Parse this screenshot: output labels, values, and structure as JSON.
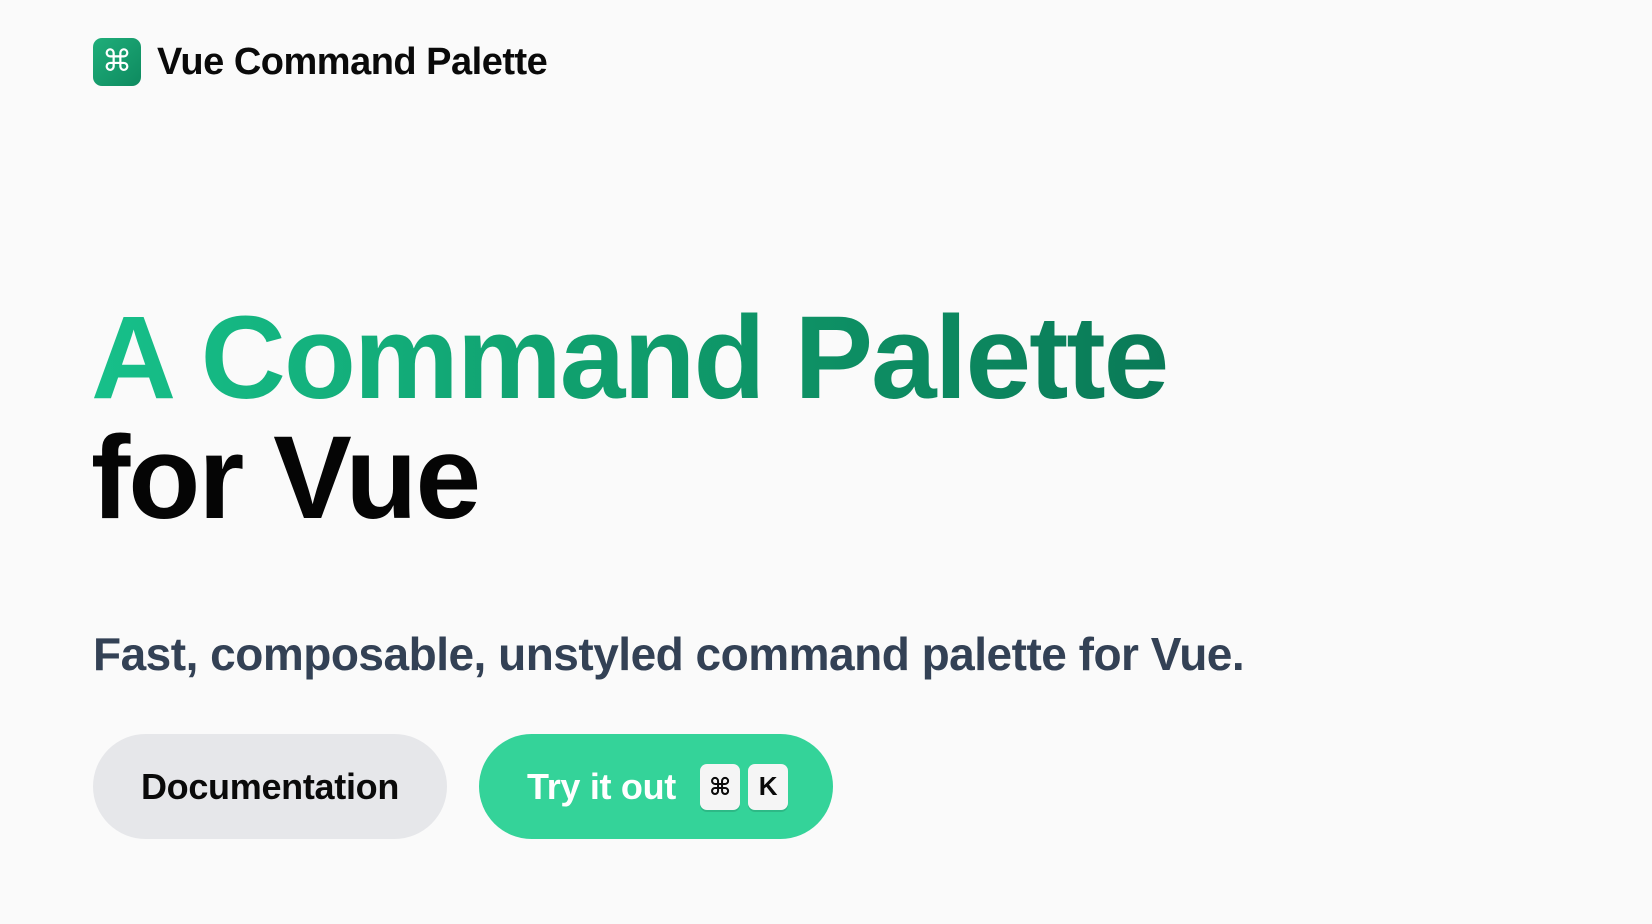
{
  "header": {
    "logo_icon": "⌘",
    "brand": "Vue Command Palette"
  },
  "hero": {
    "title_line1": "A Command Palette",
    "title_line2": "for Vue",
    "subtitle": "Fast, composable, unstyled command palette for Vue."
  },
  "actions": {
    "docs_label": "Documentation",
    "try_label": "Try it out",
    "shortcut_keys": [
      "⌘",
      "K"
    ]
  },
  "colors": {
    "accent": "#34d399",
    "heading_gradient_start": "#17c08a",
    "heading_gradient_end": "#0a7a57",
    "subtitle": "#334155",
    "background": "#fafafa"
  }
}
